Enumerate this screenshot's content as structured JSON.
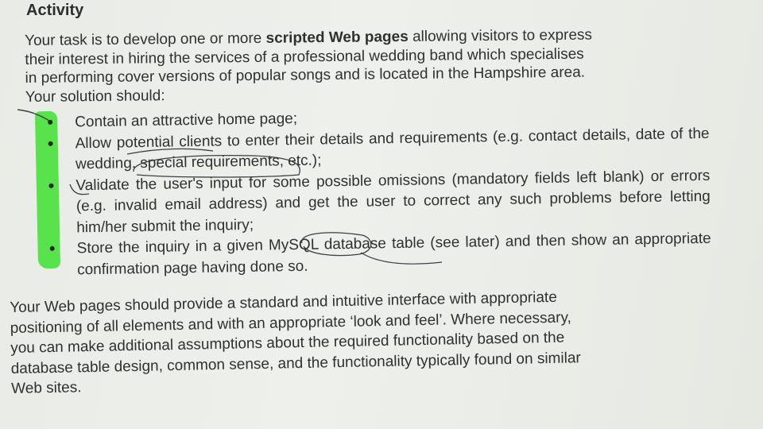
{
  "activity": {
    "title": "Activity",
    "intro": {
      "line1_before": "Your task is to develop one or more ",
      "line1_bold": "scripted Web pages",
      "line1_after": " allowing visitors to express",
      "line2": "their interest in hiring the services of a professional wedding band which specialises",
      "line3": "in performing cover versions of popular songs and is located in the Hampshire area.",
      "line4": "Your solution should:"
    },
    "requirements": [
      "Contain an attractive home page;",
      "Allow potential clients to enter their details and requirements (e.g. contact details, date of the wedding, special requirements, etc.);",
      "Validate the user's input for some possible omissions (mandatory fields left blank) or errors (e.g. invalid email address) and get the user to correct any such problems before letting him/her submit the inquiry;",
      "Store the inquiry in a given MySQL database table (see later) and then show an appropriate confirmation page having done so."
    ],
    "closing": [
      "Your Web pages should provide a standard and intuitive interface with appropriate",
      "positioning of all elements and with an appropriate ‘look and feel’.  Where necessary,",
      "you can make additional assumptions about the required functionality based on the",
      "database table design, common sense, and the functionality typically found on similar",
      "Web sites."
    ]
  },
  "colors": {
    "paper": "#eceee9",
    "ink": "#2e3131",
    "highlighter": "#3ee02f",
    "pen": "#3a3f45"
  }
}
